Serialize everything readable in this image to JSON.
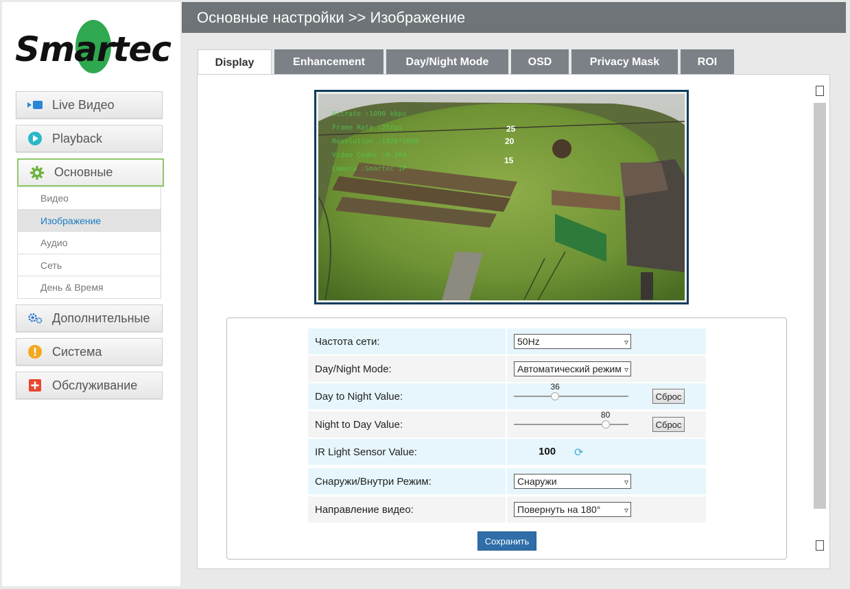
{
  "brand": {
    "logo_text": "Smartec"
  },
  "nav": {
    "items": [
      {
        "label": "Live Видео"
      },
      {
        "label": "Playback"
      },
      {
        "label": "Основные"
      },
      {
        "label": "Дополнительные"
      },
      {
        "label": "Система"
      },
      {
        "label": "Обслуживание"
      }
    ],
    "submenu": [
      {
        "label": "Видео"
      },
      {
        "label": "Изображение"
      },
      {
        "label": "Аудио"
      },
      {
        "label": "Сеть"
      },
      {
        "label": "День & Время"
      }
    ]
  },
  "header": {
    "title": "Основные настройки >> Изображение"
  },
  "tabs": [
    {
      "label": "Display"
    },
    {
      "label": "Enhancement"
    },
    {
      "label": "Day/Night Mode"
    },
    {
      "label": "OSD"
    },
    {
      "label": "Privacy Mask"
    },
    {
      "label": "ROI"
    }
  ],
  "preview": {
    "osd_lines": [
      "Bitrate :1090 kbps",
      "Frame Rate :25fps",
      "Resolution :1920*1080",
      "Video Codec :H.264",
      "Camera :Smartec IP"
    ],
    "ruler_marks": [
      "25",
      "20",
      "15"
    ]
  },
  "settings": {
    "power_freq": {
      "label": "Частота сети:",
      "value": "50Hz"
    },
    "day_night_mode": {
      "label": "Day/Night Mode:",
      "value": "Автоматический режим"
    },
    "day_to_night": {
      "label": "Day to Night Value:",
      "value": 36,
      "max": 100,
      "reset": "Сброс"
    },
    "night_to_day": {
      "label": "Night to Day Value:",
      "value": 80,
      "max": 100,
      "reset": "Сброс"
    },
    "ir_sensor": {
      "label": "IR Light Sensor Value:",
      "value": "100"
    },
    "indoor_outdoor": {
      "label": "Снаружи/Внутри Режим:",
      "value": "Снаружи"
    },
    "video_direction": {
      "label": "Направление видео:",
      "value": "Повернуть на 180°"
    },
    "save_label": "Сохранить"
  },
  "colors": {
    "header_bg": "#6e7478",
    "tab_bg": "#7c8187",
    "accent_blue": "#2f6ea8",
    "active_border": "#8fc76b",
    "row_blue": "#e6f6fc"
  }
}
